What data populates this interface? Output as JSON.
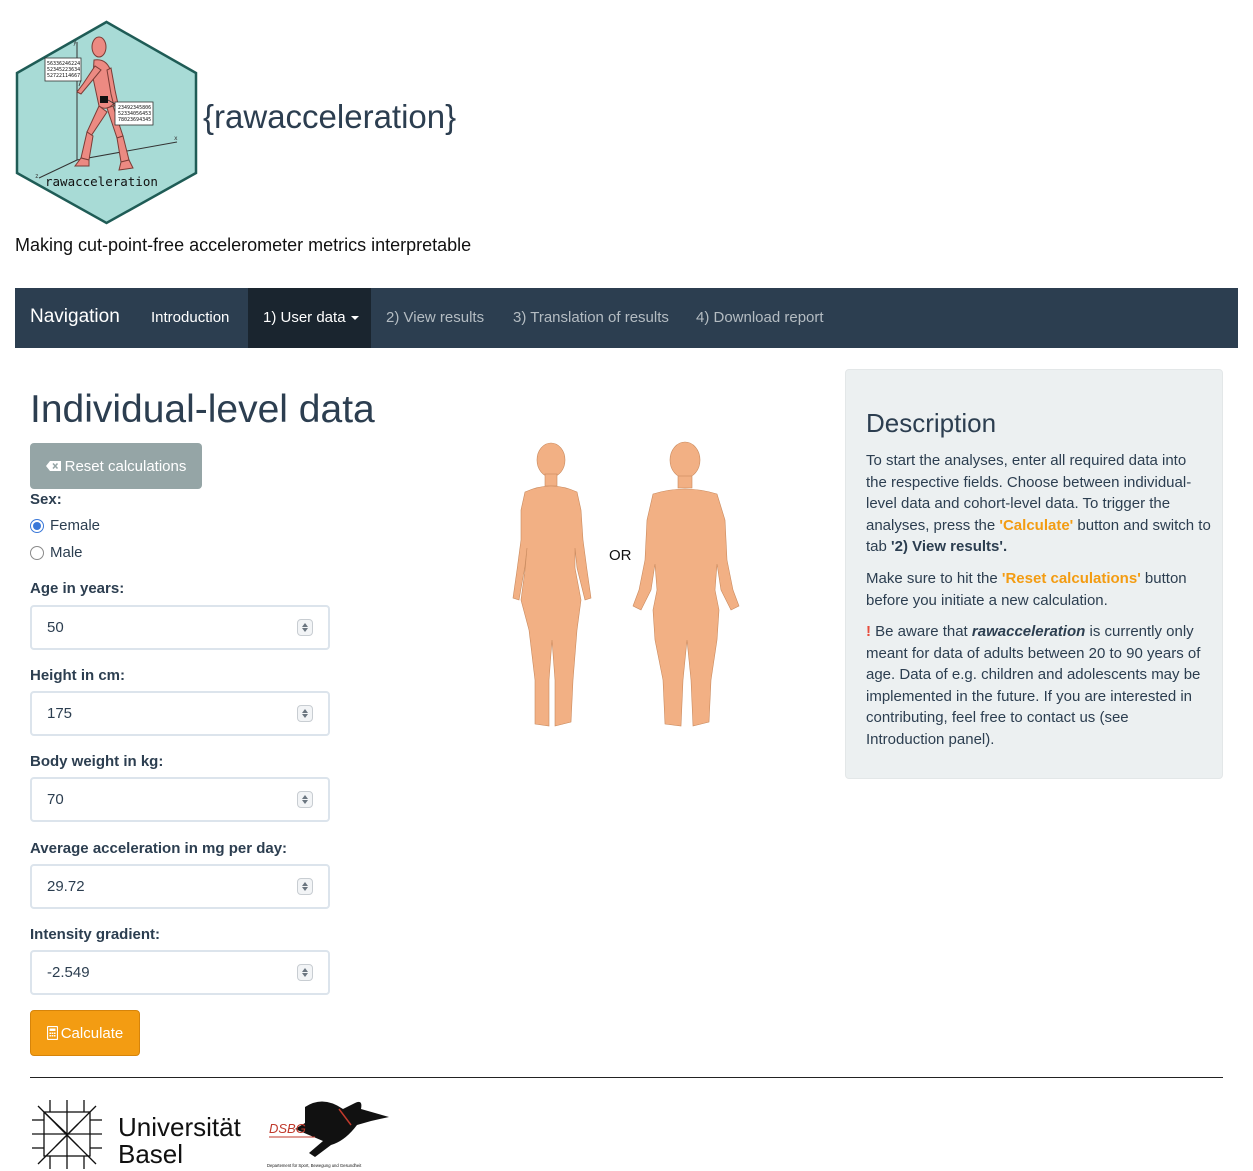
{
  "header": {
    "logo_text": "rawacceleration",
    "logo_numbers_1": [
      "56336246224",
      "52345223634",
      "52722114667"
    ],
    "logo_numbers_2": [
      "23492345806",
      "52334056453",
      "78023694345"
    ],
    "title": "{rawacceleration}",
    "tagline": "Making cut-point-free accelerometer metrics interpretable"
  },
  "nav": {
    "brand": "Navigation",
    "items": [
      {
        "label": "Introduction",
        "active": false
      },
      {
        "label": "1) User data",
        "active": true,
        "dropdown": true
      },
      {
        "label": "2) View results",
        "active": false
      },
      {
        "label": "3) Translation of results",
        "active": false
      },
      {
        "label": "4) Download report",
        "active": false
      }
    ]
  },
  "main": {
    "title": "Individual-level data",
    "reset_label": "Reset calculations",
    "sex": {
      "label": "Sex:",
      "options": [
        "Female",
        "Male"
      ],
      "selected": "Female"
    },
    "fields": [
      {
        "label": "Age in years:",
        "value": "50"
      },
      {
        "label": "Height in cm:",
        "value": "175"
      },
      {
        "label": "Body weight in kg:",
        "value": "70"
      },
      {
        "label": "Average acceleration in mg per day:",
        "value": "29.72"
      },
      {
        "label": "Intensity gradient:",
        "value": "-2.549"
      }
    ],
    "calculate_label": "Calculate",
    "figure_or": "OR"
  },
  "description": {
    "title": "Description",
    "p1_a": "To start the analyses, enter all required data into the respective fields. Choose between individual-level data and cohort-level data. To trigger the analyses, press the ",
    "p1_b": "'Calculate'",
    "p1_c": " button and switch to tab ",
    "p1_d": "'2) View results'.",
    "p2_a": "Make sure to hit the ",
    "p2_b": "'Reset calculations'",
    "p2_c": " button before you initiate a new calculation.",
    "p3_mark": "!",
    "p3_a": " Be aware that ",
    "p3_b": "rawacceleration",
    "p3_c": " is currently only meant for data of adults between 20 to 90 years of age. Data of e.g. children and adolescents may be implemented in the future. If you are interested in contributing, feel free to contact us (see Introduction panel)."
  },
  "footer": {
    "university_line1": "Universität",
    "university_line2": "Basel",
    "dsbg_label": "DSBG",
    "dsbg_caption": "Departement für Sport, Bewegung und Gesundheit"
  },
  "colors": {
    "navbar": "#2c3e50",
    "nav_active": "#1a252f",
    "reset_button": "#95a5a6",
    "calculate_button": "#f39c12",
    "description_bg": "#ecf0f1",
    "logo_hex": "#a8dbd6",
    "body_figure": "#f2b084"
  },
  "icons": {
    "reset": "backspace-icon",
    "calculate": "calculator-icon"
  }
}
